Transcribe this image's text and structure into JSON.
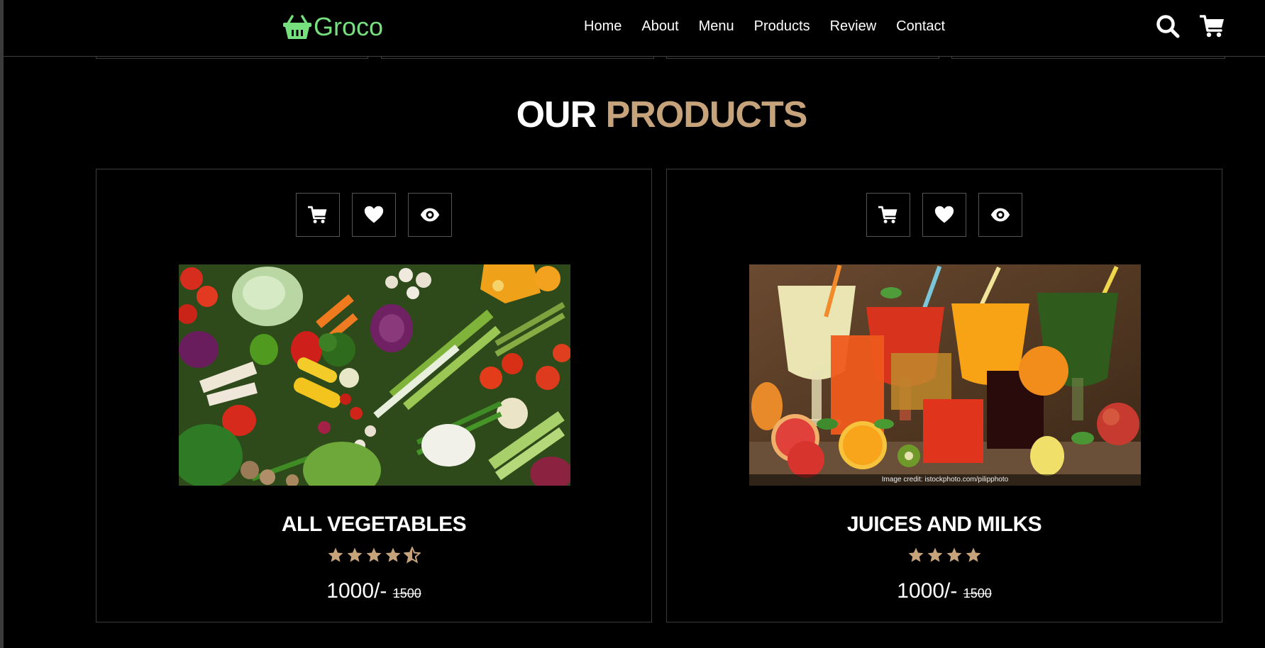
{
  "header": {
    "logo_text": "Groco",
    "logo_icon": "basket-icon",
    "nav": [
      "Home",
      "About",
      "Menu",
      "Products",
      "Review",
      "Contact"
    ],
    "icons": [
      "search-icon",
      "cart-icon"
    ]
  },
  "section": {
    "title_part1": "OUR",
    "title_part2": "PRODUCTS"
  },
  "colors": {
    "background": "#000000",
    "logo_green": "#77e07e",
    "accent_tan": "#c6a37b",
    "border": "#3c3c3c"
  },
  "products": [
    {
      "name": "ALL VEGETABLES",
      "rating": 4.5,
      "price": "1000/-",
      "old_price": "1500",
      "image_credit": "",
      "actions": [
        "cart-icon",
        "heart-icon",
        "eye-icon"
      ]
    },
    {
      "name": "JUICES AND MILKS",
      "rating": 4,
      "price": "1000/-",
      "old_price": "1500",
      "image_credit": "Image credit: istockphoto.com/pilipphoto",
      "actions": [
        "cart-icon",
        "heart-icon",
        "eye-icon"
      ]
    }
  ]
}
